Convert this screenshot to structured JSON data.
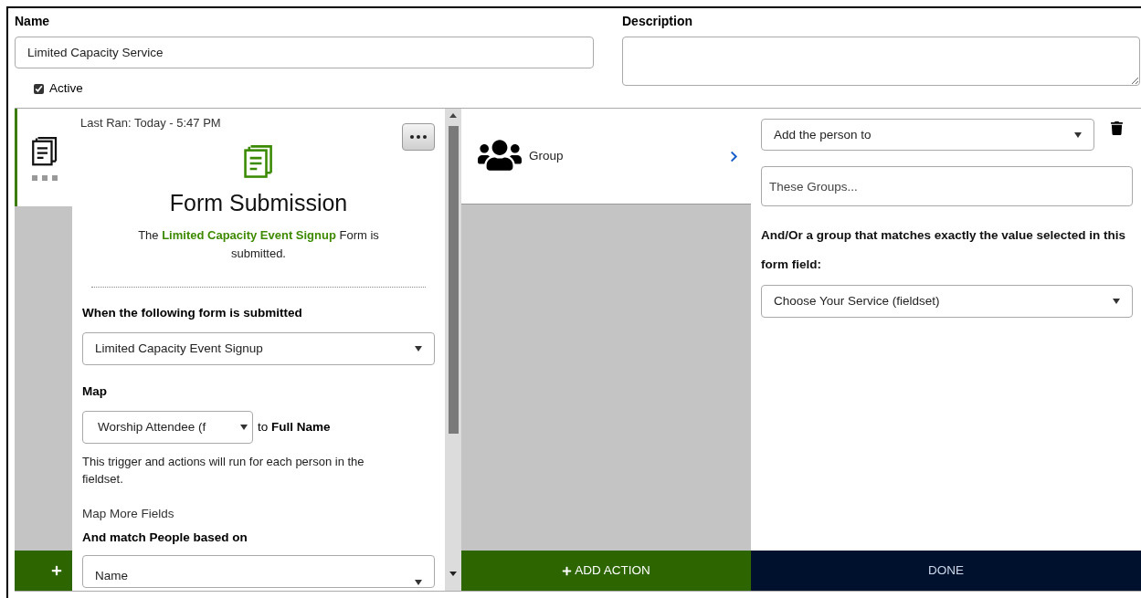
{
  "name_field": {
    "label": "Name",
    "value": "Limited Capacity Service"
  },
  "description_field": {
    "label": "Description"
  },
  "active": {
    "label": "Active",
    "checked": true
  },
  "trigger_tile": {
    "selected": true
  },
  "trigger": {
    "last_ran": "Last Ran: Today - 5:47 PM",
    "title": "Form Submission",
    "summary_before": "The ",
    "summary_form": "Limited Capacity Event Signup",
    "summary_after": " Form is submitted.",
    "form_label": "When the following form is submitted",
    "form_select": "Limited Capacity Event Signup",
    "map_label": "Map",
    "map_select": "Worship Attendee (f",
    "map_to": "to **Full Name**",
    "note": "This trigger and actions will run for each person in the fieldset.",
    "map_more": "Map More Fields",
    "match_label": "And match People based on",
    "match_select": "Name"
  },
  "actions": [
    {
      "label": "Group",
      "selected": true
    }
  ],
  "action_config": {
    "action_select": "Add the person to",
    "groups_field": {
      "placeholder": "These Groups..."
    },
    "field_match_label": "And/Or a group that matches exactly the value selected in this form field:",
    "field_select": "Choose Your Service (fieldset)"
  },
  "buttons": {
    "add_action": "ADD ACTION",
    "done": "DONE"
  }
}
